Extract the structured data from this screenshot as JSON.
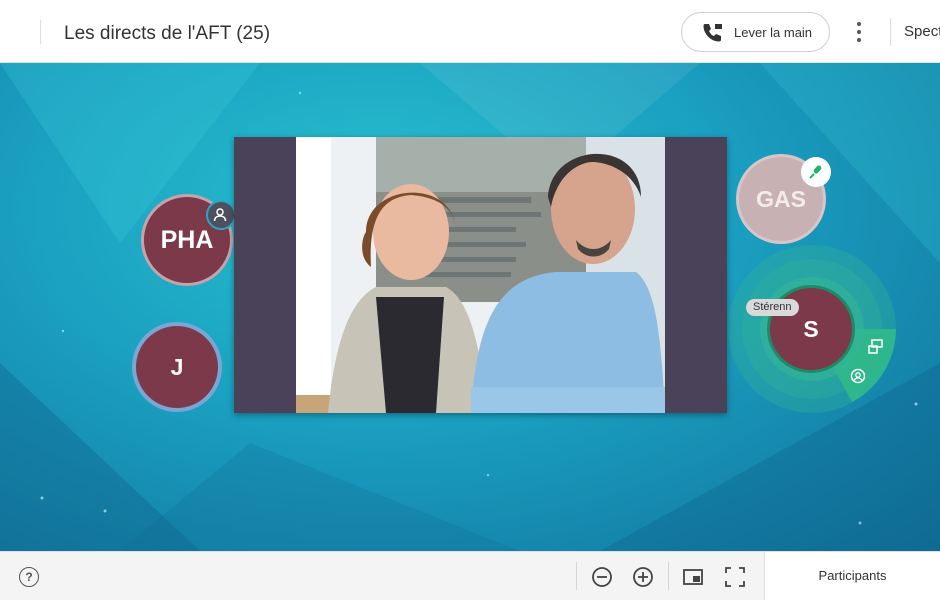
{
  "header": {
    "title": "Les directs de l'AFT (25)",
    "raise_hand_label": "Lever la main",
    "truncated_tab": "Spect"
  },
  "stage": {
    "participants": [
      {
        "initials": "PHA",
        "badge_icon": "user-host-icon"
      },
      {
        "initials": "J"
      },
      {
        "initials": "GAS",
        "badge_icon": "microphone-icon"
      },
      {
        "initials": "S",
        "name_tag": "Stérenn",
        "speaking": true
      }
    ]
  },
  "footer": {
    "participants_label": "Participants",
    "help_glyph": "?"
  },
  "colors": {
    "avatar": "#7c3949",
    "speaking_ring": "#2fb88a",
    "stage_teal": "#1fa8c6"
  }
}
